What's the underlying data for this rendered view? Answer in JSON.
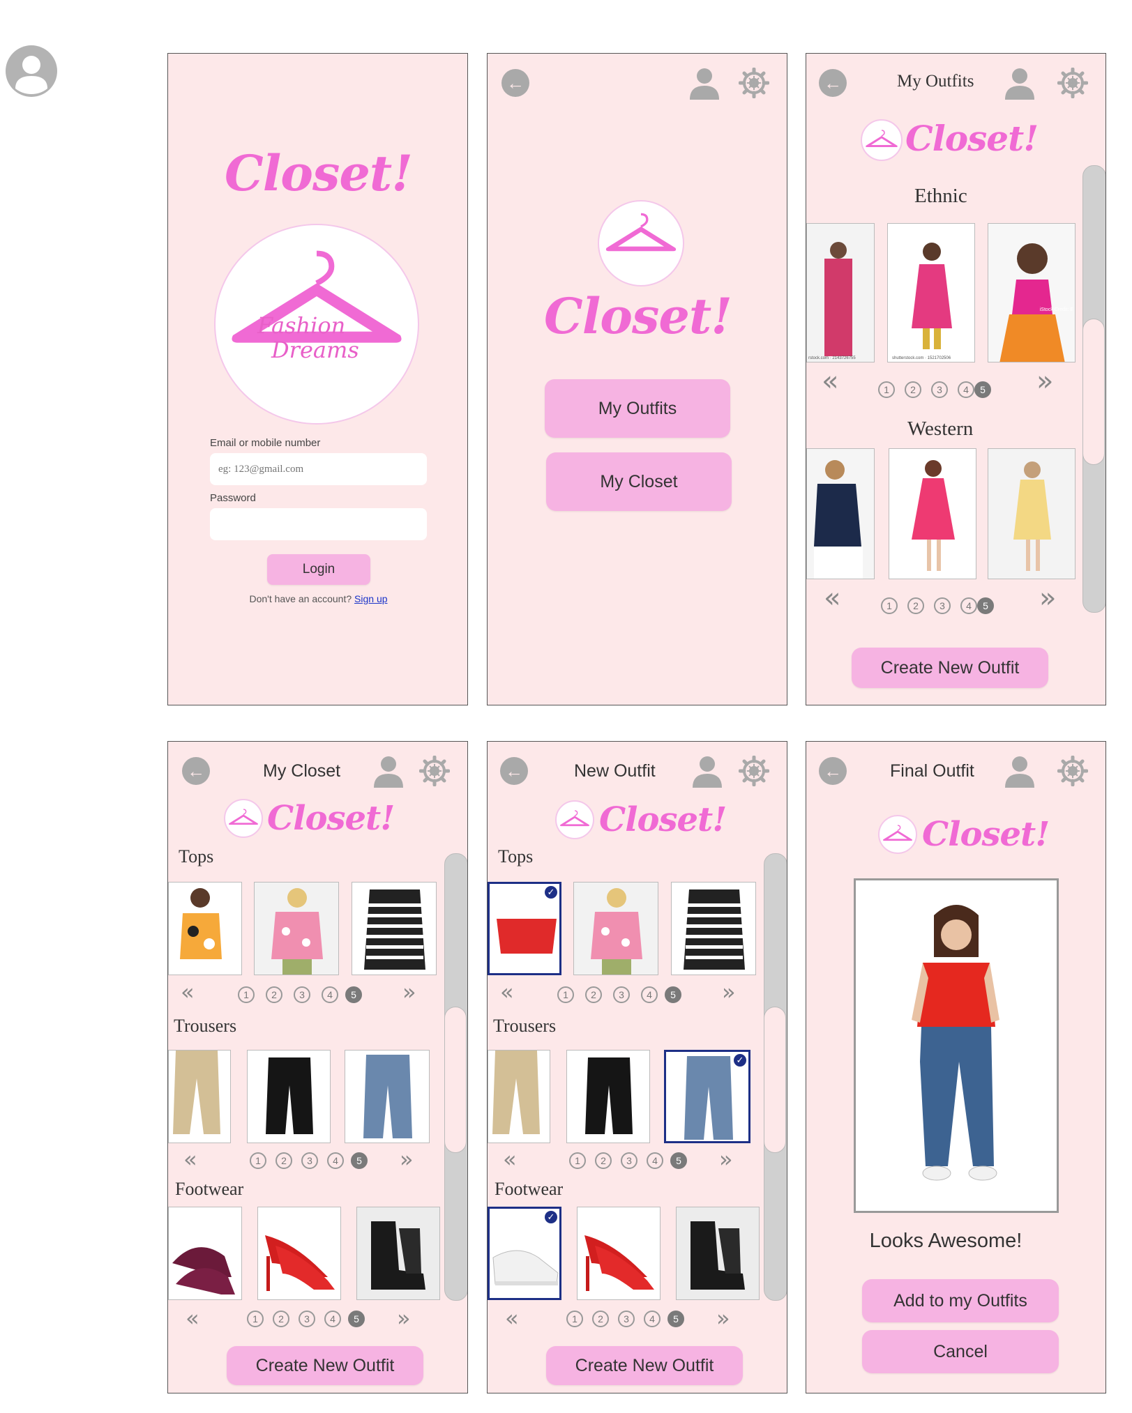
{
  "brand": "Closet!",
  "logo_text": {
    "line1": "Fashion",
    "line2": "Dreams"
  },
  "colors": {
    "screen_bg": "#fde8e9",
    "button": "#f6b3e2",
    "brand": "#f06ad4",
    "selected_border": "#1d2f86",
    "icon_gray": "#a9a9a9"
  },
  "icons": {
    "back": "arrow-left-icon",
    "profile": "person-icon",
    "settings": "gear-icon",
    "prev": "chevron-double-left-icon",
    "next": "chevron-double-right-icon"
  },
  "login": {
    "email_label": "Email or mobile number",
    "email_placeholder": "eg: 123@gmail.com",
    "password_label": "Password",
    "login_button": "Login",
    "no_account": "Don't have an account?",
    "signup_link": "Sign up"
  },
  "home": {
    "buttons": [
      "My Outfits",
      "My Closet"
    ]
  },
  "pager": [
    "1",
    "2",
    "3",
    "4",
    "5"
  ],
  "my_outfits": {
    "title": "My Outfits",
    "sections": [
      "Ethnic",
      "Western"
    ],
    "credits": [
      "rstock.com · 2143726755",
      "shutterstock.com · 1521702506",
      "iStock Credit: E"
    ],
    "create_button": "Create New Outfit"
  },
  "my_closet": {
    "title": "My Closet",
    "sections": [
      "Tops",
      "Trousers",
      "Footwear"
    ],
    "create_button": "Create New Outfit"
  },
  "new_outfit": {
    "title": "New Outfit",
    "sections": [
      "Tops",
      "Trousers",
      "Footwear"
    ],
    "create_button": "Create New Outfit"
  },
  "final_outfit": {
    "title": "Final Outfit",
    "message": "Looks Awesome!",
    "add_button": "Add to my Outfits",
    "cancel_button": "Cancel"
  }
}
